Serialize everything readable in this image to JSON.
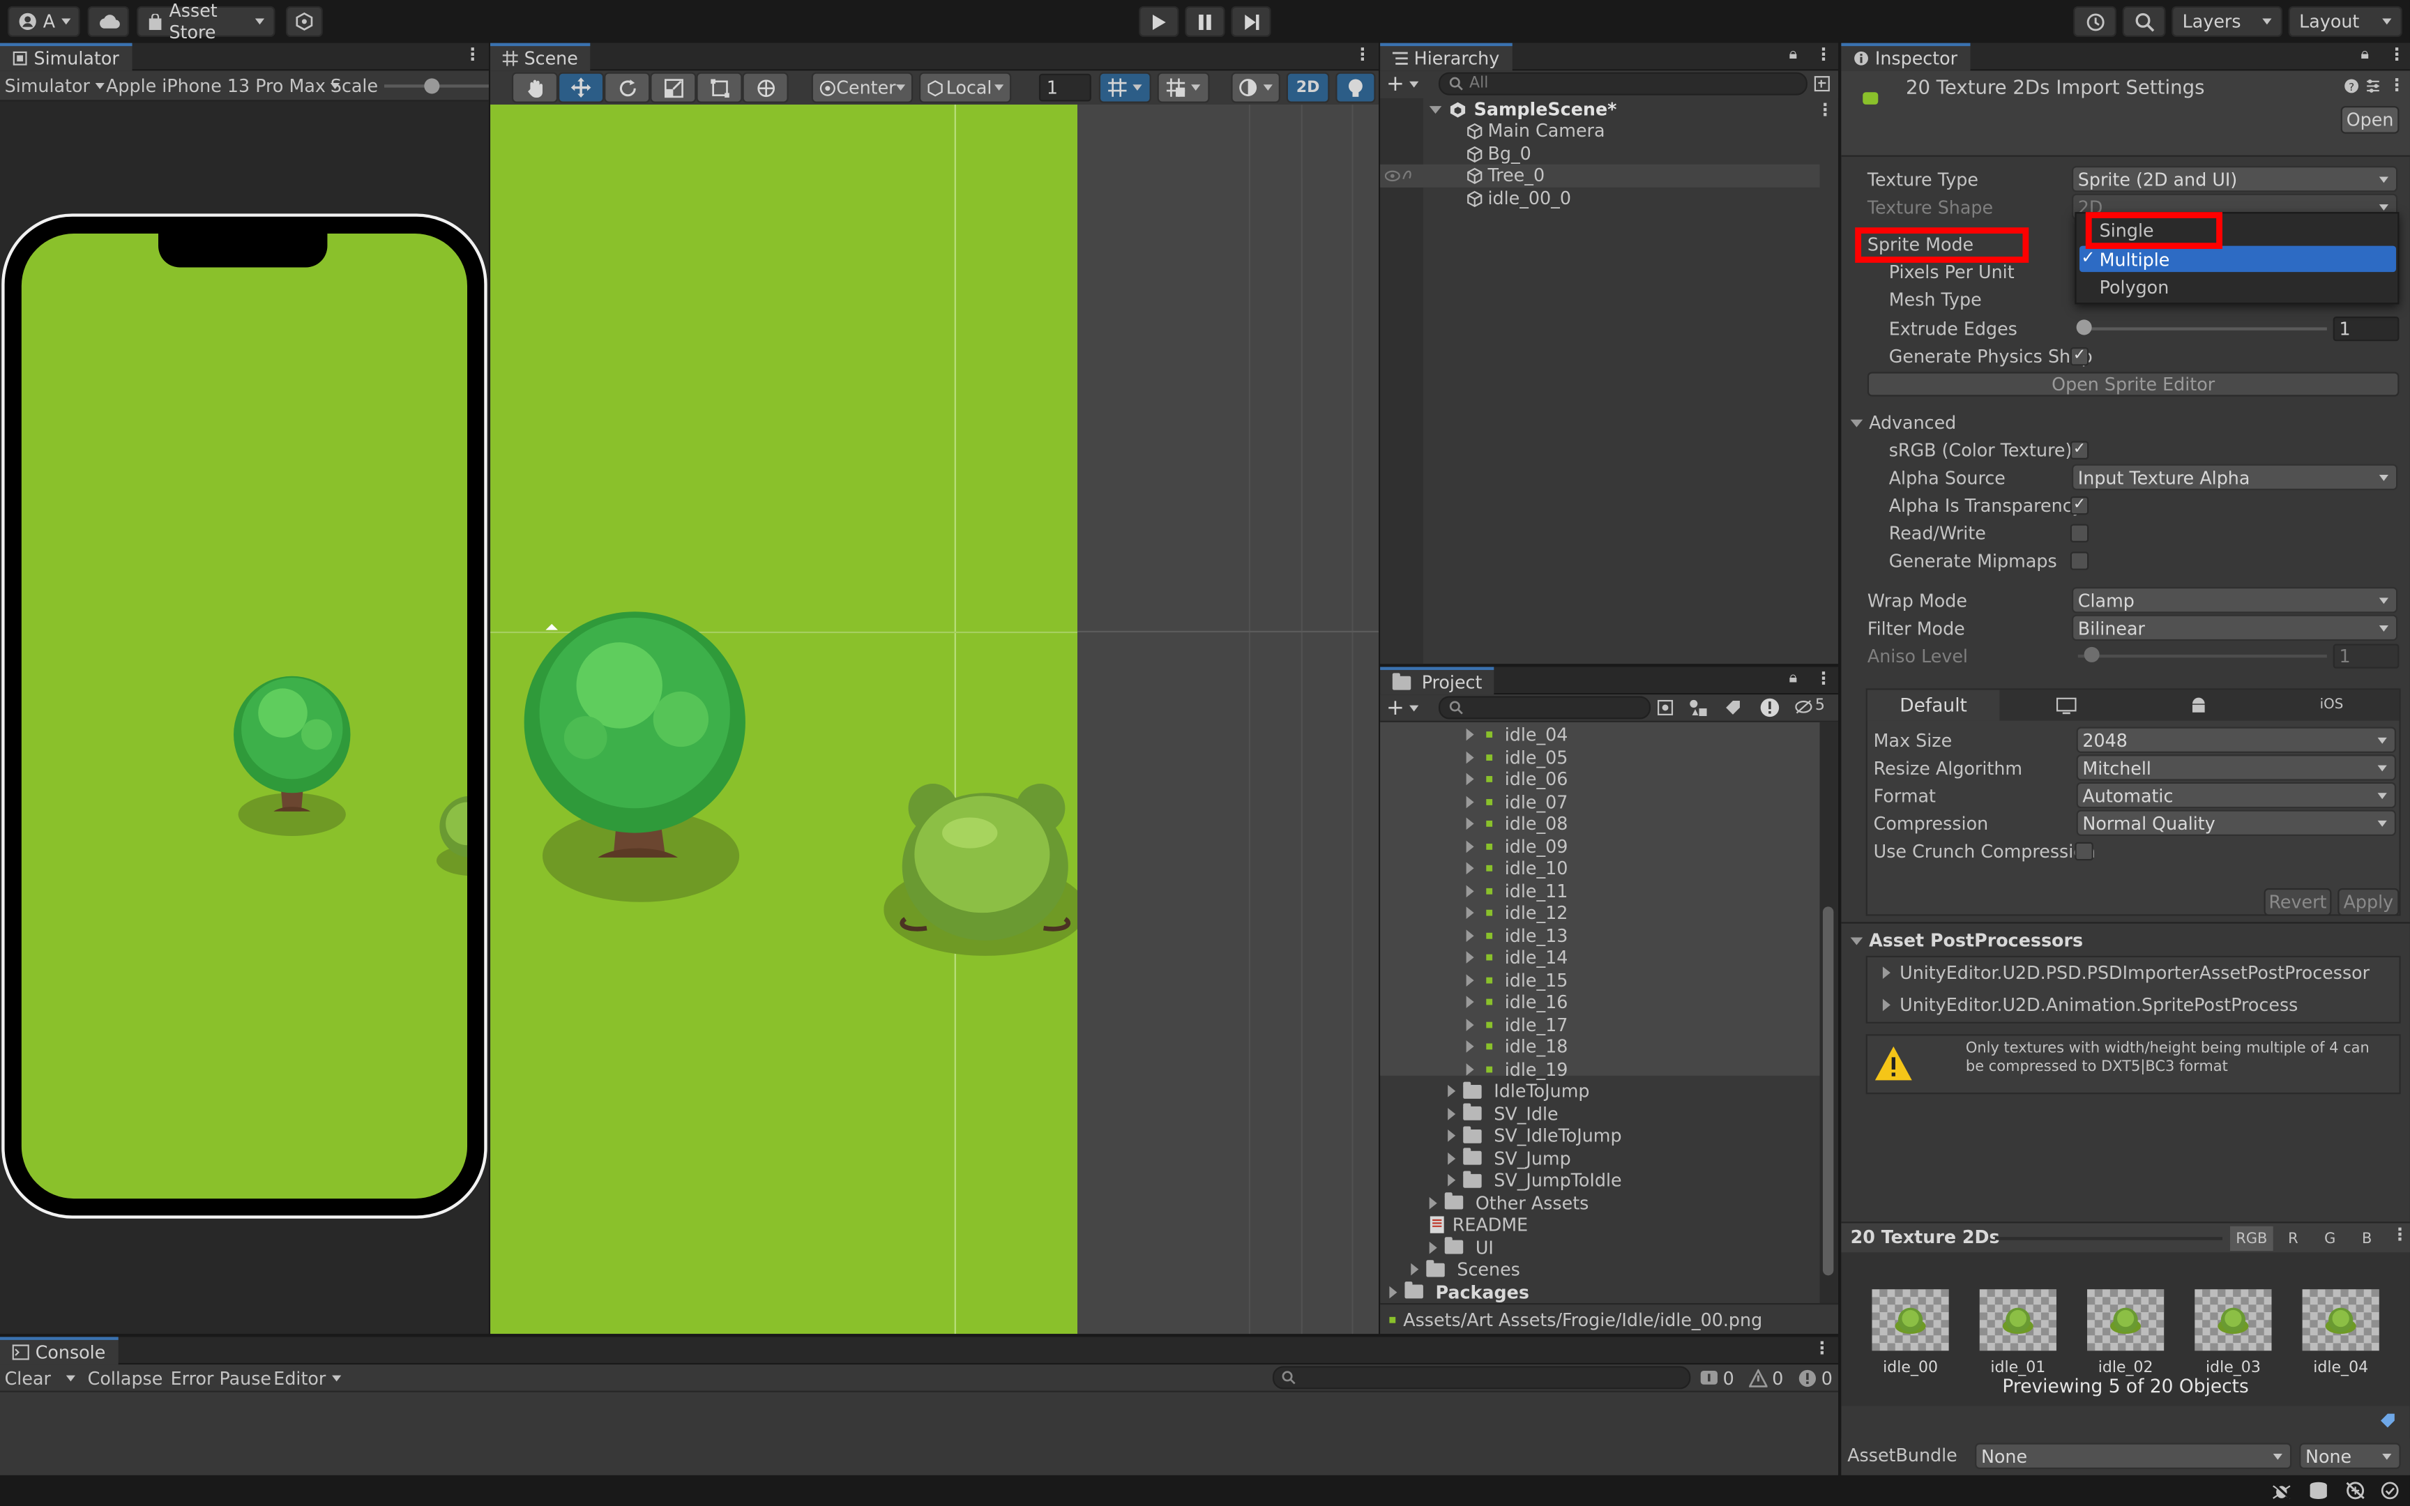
{
  "toolbar": {
    "account_label": "A",
    "asset_store_label": "Asset Store",
    "layers_label": "Layers",
    "layout_label": "Layout"
  },
  "simulator": {
    "tab_label": "Simulator",
    "mode_label": "Simulator",
    "device_label": "Apple iPhone 13 Pro Max",
    "scale_label": "Scale",
    "scale_value": 0.45
  },
  "scene": {
    "tab_label": "Scene",
    "pivot_label": "Center",
    "space_label": "Local",
    "grid_value": "1",
    "mode_2d_label": "2D"
  },
  "hierarchy": {
    "tab_label": "Hierarchy",
    "search_placeholder": "All",
    "scene_name": "SampleScene*",
    "items": [
      {
        "label": "Main Camera"
      },
      {
        "label": "Bg_0"
      },
      {
        "label": "Tree_0"
      },
      {
        "label": "idle_00_0"
      }
    ]
  },
  "project": {
    "tab_label": "Project",
    "hidden_count": "5",
    "sprites": [
      "idle_04",
      "idle_05",
      "idle_06",
      "idle_07",
      "idle_08",
      "idle_09",
      "idle_10",
      "idle_11",
      "idle_12",
      "idle_13",
      "idle_14",
      "idle_15",
      "idle_16",
      "idle_17",
      "idle_18",
      "idle_19"
    ],
    "subfolders": [
      "IdleToJump",
      "SV_Idle",
      "SV_IdleToJump",
      "SV_Jump",
      "SV_JumpToIdle"
    ],
    "other_assets": "Other Assets",
    "readme": "README",
    "ui_folder": "UI",
    "scenes_folder": "Scenes",
    "packages_folder": "Packages",
    "path": "Assets/Art Assets/Frogie/Idle/idle_00.png"
  },
  "inspector": {
    "tab_label": "Inspector",
    "title": "20 Texture 2Ds Import Settings",
    "open_button": "Open",
    "texture_type_label": "Texture Type",
    "texture_type_value": "Sprite (2D and UI)",
    "texture_shape_label": "Texture Shape",
    "texture_shape_value": "2D",
    "sprite_mode_label": "Sprite Mode",
    "sprite_mode_options": [
      "Single",
      "Multiple",
      "Polygon"
    ],
    "sprite_mode_selected": "Multiple",
    "pixels_per_unit_label": "Pixels Per Unit",
    "mesh_type_label": "Mesh Type",
    "extrude_edges_label": "Extrude Edges",
    "extrude_edges_value": "1",
    "generate_physics_label": "Generate Physics Shap",
    "open_sprite_editor": "Open Sprite Editor",
    "advanced_label": "Advanced",
    "srgb_label": "sRGB (Color Texture)",
    "alpha_source_label": "Alpha Source",
    "alpha_source_value": "Input Texture Alpha",
    "alpha_transparency_label": "Alpha Is Transparency",
    "read_write_label": "Read/Write",
    "generate_mipmaps_label": "Generate Mipmaps",
    "wrap_mode_label": "Wrap Mode",
    "wrap_mode_value": "Clamp",
    "filter_mode_label": "Filter Mode",
    "filter_mode_value": "Bilinear",
    "aniso_label": "Aniso Level",
    "aniso_value": "1",
    "platform_default_tab": "Default",
    "platform_ios_tab": "iOS",
    "max_size_label": "Max Size",
    "max_size_value": "2048",
    "resize_label": "Resize Algorithm",
    "resize_value": "Mitchell",
    "format_label": "Format",
    "format_value": "Automatic",
    "compression_label": "Compression",
    "compression_value": "Normal Quality",
    "crunch_label": "Use Crunch Compression",
    "revert_button": "Revert",
    "apply_button": "Apply",
    "postprocessors_label": "Asset PostProcessors",
    "postprocessors": [
      "UnityEditor.U2D.PSD.PSDImporterAssetPostProcessor",
      "UnityEditor.U2D.Animation.SpritePostProcess"
    ],
    "warning_text": "Only textures with width/height being multiple of 4 can be compressed to DXT5|BC3 format",
    "preview_title": "20 Texture 2Ds",
    "channel_rgb": "RGB",
    "channel_r": "R",
    "channel_g": "G",
    "channel_b": "B",
    "previews": [
      "idle_00",
      "idle_01",
      "idle_02",
      "idle_03",
      "idle_04"
    ],
    "preview_caption": "Previewing 5 of 20 Objects",
    "assetbundle_label": "AssetBundle",
    "assetbundle_value": "None",
    "assetbundle_variant": "None"
  },
  "console": {
    "tab_label": "Console",
    "clear_label": "Clear",
    "collapse_label": "Collapse",
    "error_pause_label": "Error Pause",
    "editor_label": "Editor",
    "log_count": "0",
    "warning_count": "0",
    "error_count": "0"
  },
  "colors": {
    "accent": "#2c5d87",
    "selection": "#2d6bc4",
    "grass": "#8ac12b",
    "highlight_box": "#ff0000"
  }
}
